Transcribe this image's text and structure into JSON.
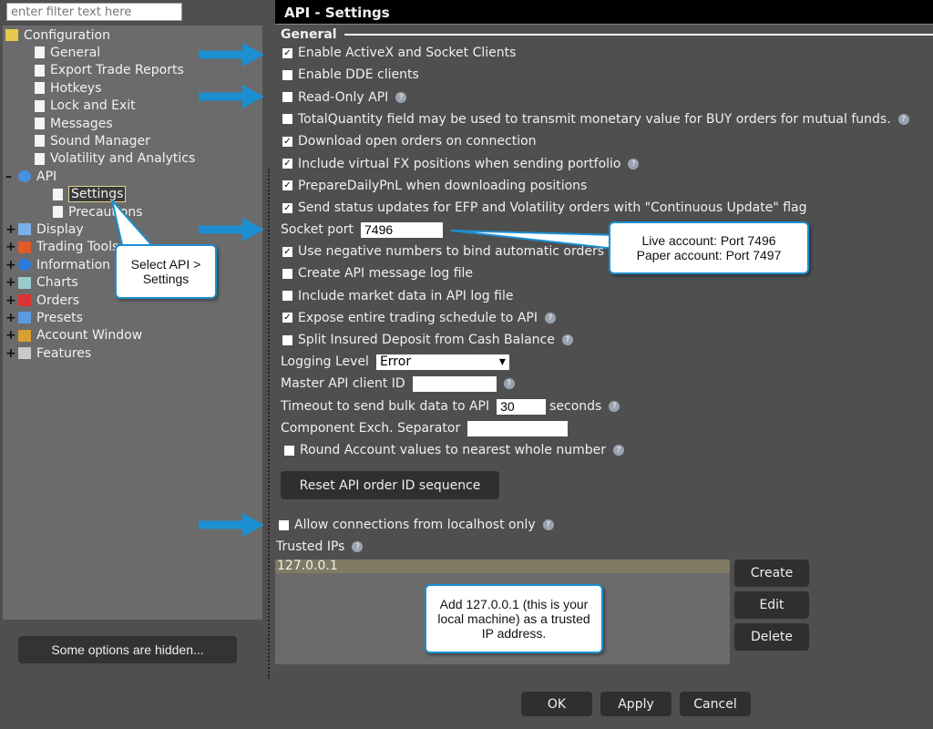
{
  "filter": {
    "placeholder": "enter filter text here"
  },
  "tree": {
    "items": [
      {
        "label": "Configuration",
        "icon": "folder-icon"
      },
      {
        "label": "General",
        "icon": "page-icon"
      },
      {
        "label": "Export Trade Reports",
        "icon": "page-icon"
      },
      {
        "label": "Hotkeys",
        "icon": "page-icon"
      },
      {
        "label": "Lock and Exit",
        "icon": "page-icon"
      },
      {
        "label": "Messages",
        "icon": "page-icon"
      },
      {
        "label": "Sound Manager",
        "icon": "page-icon"
      },
      {
        "label": "Volatility and Analytics",
        "icon": "page-icon"
      },
      {
        "label": "API",
        "icon": "api-arrows-icon"
      },
      {
        "label": "Settings",
        "icon": "page-icon",
        "selected": true
      },
      {
        "label": "Precautions",
        "icon": "page-icon"
      },
      {
        "label": "Display",
        "icon": "display-icon"
      },
      {
        "label": "Trading Tools",
        "icon": "trading-tools-icon"
      },
      {
        "label": "Information",
        "icon": "info-icon"
      },
      {
        "label": "Charts",
        "icon": "chart-icon"
      },
      {
        "label": "Orders",
        "icon": "orders-icon"
      },
      {
        "label": "Presets",
        "icon": "presets-icon"
      },
      {
        "label": "Account Window",
        "icon": "coins-icon"
      },
      {
        "label": "Features",
        "icon": "features-icon"
      }
    ]
  },
  "hidden_button": "Some options are hidden...",
  "header": {
    "title": "API - Settings"
  },
  "group": "General",
  "options": [
    {
      "label": "Enable ActiveX and Socket Clients",
      "checked": true,
      "help": false
    },
    {
      "label": "Enable DDE clients",
      "checked": false,
      "help": false
    },
    {
      "label": "Read-Only API",
      "checked": false,
      "help": true
    },
    {
      "label": "TotalQuantity field may be used to transmit monetary value for BUY orders for mutual funds.",
      "checked": false,
      "help": true
    },
    {
      "label": "Download open orders on connection",
      "checked": true,
      "help": false
    },
    {
      "label": "Include virtual FX positions when sending portfolio",
      "checked": true,
      "help": true
    },
    {
      "label": "PrepareDailyPnL when downloading positions",
      "checked": true,
      "help": false
    },
    {
      "label": "Send status updates for EFP and Volatility orders with \"Continuous Update\" flag",
      "checked": true,
      "help": false
    }
  ],
  "socket_port": {
    "label": "Socket port",
    "value": "7496"
  },
  "options2": [
    {
      "label": "Use negative numbers to bind automatic orders",
      "checked": true,
      "help": false
    },
    {
      "label": "Create API message log file",
      "checked": false,
      "help": false
    },
    {
      "label": "Include market data in API log file",
      "checked": false,
      "help": false
    },
    {
      "label": "Expose entire trading schedule to API",
      "checked": true,
      "help": true
    },
    {
      "label": "Split Insured Deposit from Cash Balance",
      "checked": false,
      "help": true
    }
  ],
  "logging": {
    "label": "Logging Level",
    "value": "Error"
  },
  "master_id": {
    "label": "Master API client ID",
    "value": ""
  },
  "timeout": {
    "label": "Timeout to send bulk data to API",
    "value": "30",
    "unit": "seconds"
  },
  "separator": {
    "label": "Component Exch. Separator",
    "value": ""
  },
  "round": {
    "label": "Round Account values to nearest whole number",
    "checked": false
  },
  "reset_button": "Reset API order ID sequence",
  "localhost": {
    "label": "Allow connections from localhost only",
    "checked": false
  },
  "trusted": {
    "label": "Trusted IPs",
    "ips": [
      "127.0.0.1"
    ]
  },
  "ip_buttons": {
    "create": "Create",
    "edit": "Edit",
    "delete": "Delete"
  },
  "footer": {
    "ok": "OK",
    "apply": "Apply",
    "cancel": "Cancel"
  },
  "callouts": {
    "select": "Select API > Settings",
    "port_live": "Live account: Port 7496",
    "port_paper": "Paper account: Port 7497",
    "add_ip": "Add 127.0.0.1 (this is your local machine) as a trusted IP address."
  },
  "colors": {
    "accent_arrow": "#1c8fd0",
    "panel": "#6b6b6b",
    "background": "#4f4f4f",
    "selected_ip": "#7f7a64"
  }
}
